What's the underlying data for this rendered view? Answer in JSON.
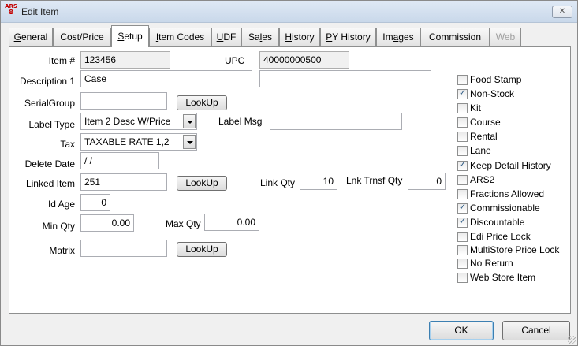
{
  "window": {
    "title": "Edit Item",
    "logo_text": "ARS",
    "logo_sub": "8",
    "close_glyph": "✕"
  },
  "tabs": [
    {
      "label": "General",
      "u": "G"
    },
    {
      "label": "Cost/Price",
      "u": ""
    },
    {
      "label": "Setup",
      "u": "S"
    },
    {
      "label": "Item Codes",
      "u": "I"
    },
    {
      "label": "UDF",
      "u": "U"
    },
    {
      "label": "Sales",
      "u": "l"
    },
    {
      "label": "History",
      "u": "H"
    },
    {
      "label": "PY History",
      "u": "P"
    },
    {
      "label": "Images",
      "u": "a"
    },
    {
      "label": "Commission",
      "u": ""
    },
    {
      "label": "Web",
      "u": ""
    }
  ],
  "active_tab": "Setup",
  "form": {
    "item_no_label": "Item #",
    "item_no": "123456",
    "upc_label": "UPC",
    "upc": "40000000500",
    "desc1_label": "Description 1",
    "desc1": "Case",
    "desc2": "",
    "serialgroup_label": "SerialGroup",
    "serialgroup": "",
    "label_type_label": "Label Type",
    "label_type": "Item 2 Desc W/Price",
    "label_msg_label": "Label Msg",
    "label_msg": "",
    "tax_label": "Tax",
    "tax": "TAXABLE RATE 1,2",
    "delete_date_label": "Delete Date",
    "delete_date": " /  /",
    "linked_item_label": "Linked Item",
    "linked_item": "251",
    "link_qty_label": "Link Qty",
    "link_qty": "10",
    "lnk_trnsf_qty_label": "Lnk Trnsf Qty",
    "lnk_trnsf_qty": "0",
    "id_age_label": "Id Age",
    "id_age": "0",
    "min_qty_label": "Min Qty",
    "min_qty": "0.00",
    "max_qty_label": "Max Qty",
    "max_qty": "0.00",
    "matrix_label": "Matrix",
    "matrix": "",
    "lookup_label": "LookUp"
  },
  "checkboxes": [
    {
      "label": "Food Stamp",
      "checked": false
    },
    {
      "label": "Non-Stock",
      "checked": true
    },
    {
      "label": "Kit",
      "checked": false
    },
    {
      "label": "Course",
      "checked": false
    },
    {
      "label": "Rental",
      "checked": false
    },
    {
      "label": "Lane",
      "checked": false
    },
    {
      "label": "Keep Detail History",
      "checked": true
    },
    {
      "label": "ARS2",
      "checked": false
    },
    {
      "label": "Fractions Allowed",
      "checked": false
    },
    {
      "label": "Commissionable",
      "checked": true
    },
    {
      "label": "Discountable",
      "checked": true
    },
    {
      "label": "Edi Price Lock",
      "checked": false
    },
    {
      "label": "MultiStore Price Lock",
      "checked": false
    },
    {
      "label": "No Return",
      "checked": false
    },
    {
      "label": "Web Store Item",
      "checked": false
    }
  ],
  "buttons": {
    "ok": "OK",
    "cancel": "Cancel"
  }
}
